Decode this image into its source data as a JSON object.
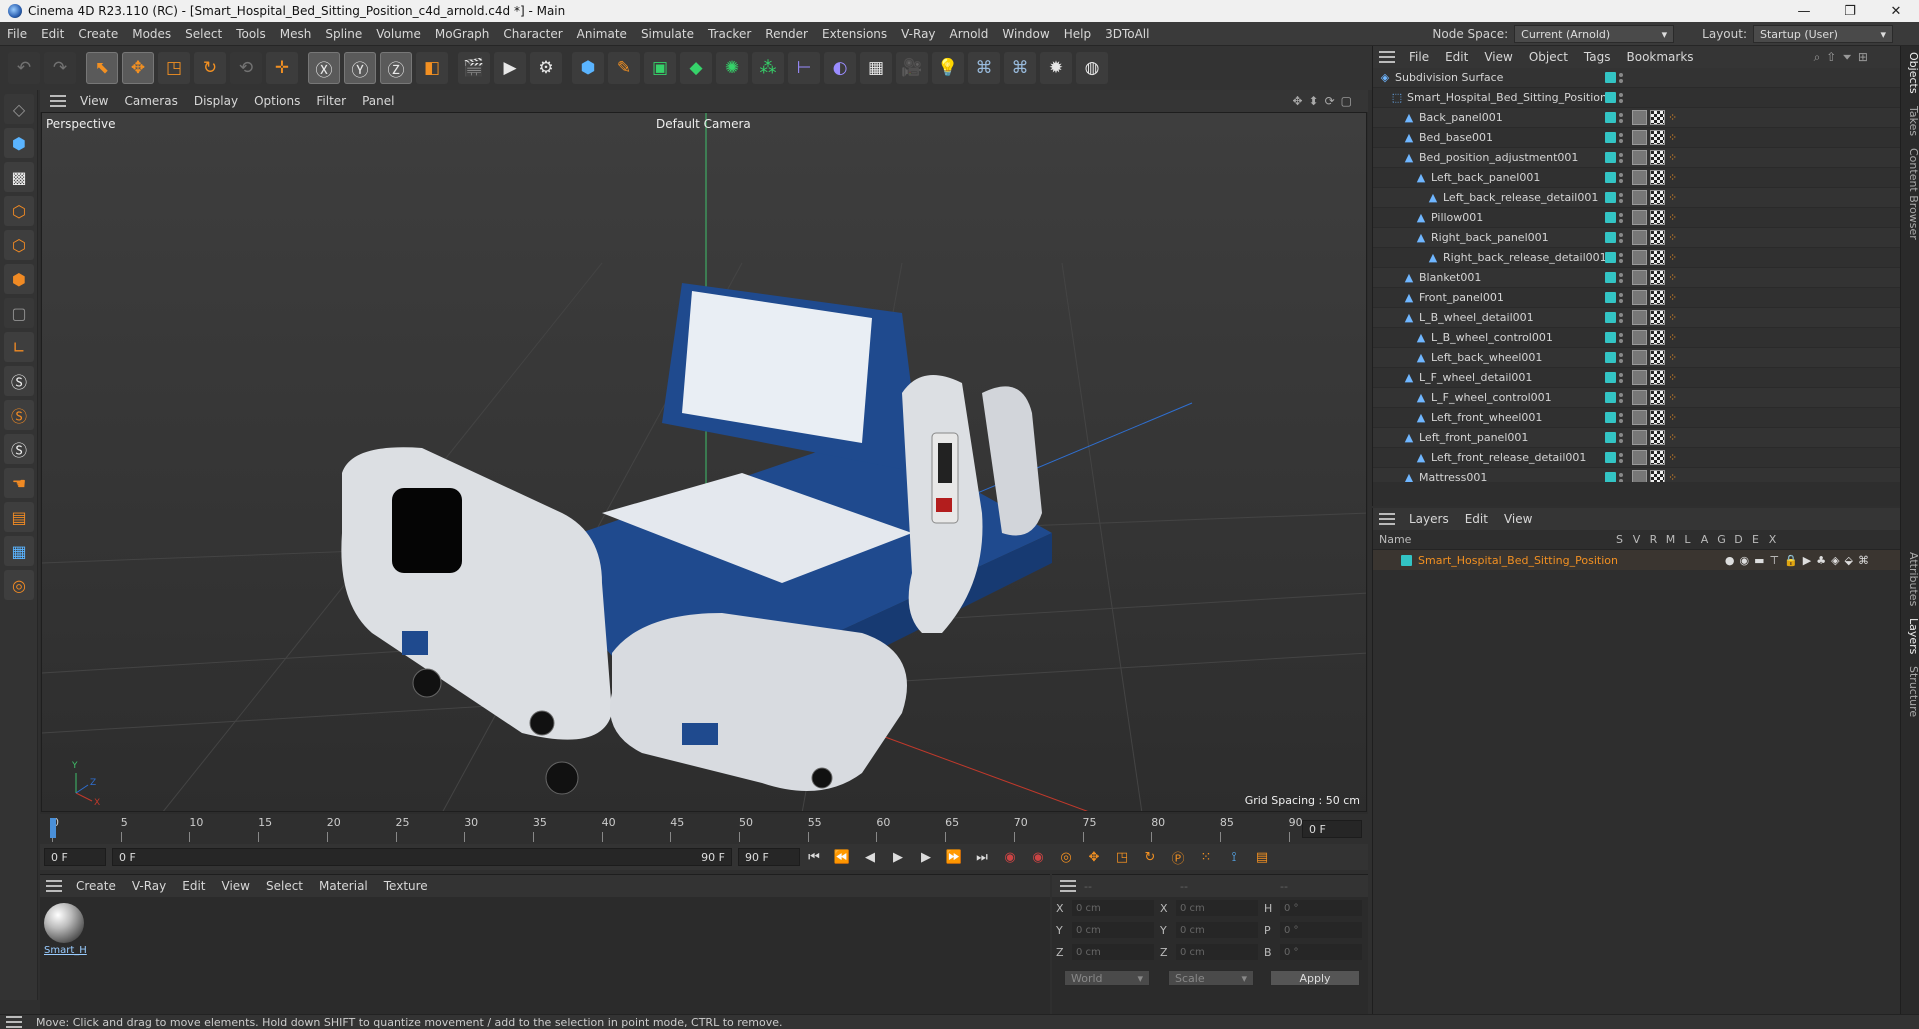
{
  "window": {
    "title": "Cinema 4D R23.110 (RC) - [Smart_Hospital_Bed_Sitting_Position_c4d_arnold.c4d *] - Main",
    "controls": [
      "—",
      "❐",
      "✕"
    ]
  },
  "menubar": {
    "items": [
      "File",
      "Edit",
      "Create",
      "Modes",
      "Select",
      "Tools",
      "Mesh",
      "Spline",
      "Volume",
      "MoGraph",
      "Character",
      "Animate",
      "Simulate",
      "Tracker",
      "Render",
      "Extensions",
      "V-Ray",
      "Arnold",
      "Window",
      "Help",
      "3DToAll"
    ],
    "node_space_label": "Node Space:",
    "node_space_value": "Current (Arnold)",
    "layout_label": "Layout:",
    "layout_value": "Startup (User)"
  },
  "viewport": {
    "menu": [
      "View",
      "Cameras",
      "Display",
      "Options",
      "Filter",
      "Panel"
    ],
    "view_name": "Perspective",
    "camera": "Default Camera",
    "grid_spacing": "Grid Spacing : 50 cm"
  },
  "timeline": {
    "ticks": [
      "0",
      "5",
      "10",
      "15",
      "20",
      "25",
      "30",
      "35",
      "40",
      "45",
      "50",
      "55",
      "60",
      "65",
      "70",
      "75",
      "80",
      "85",
      "90"
    ],
    "current_frame_right": "0 F",
    "start_field": "0 F",
    "range_start": "0 F",
    "range_end": "90 F",
    "end_field": "90 F"
  },
  "material_panel": {
    "menu": [
      "Create",
      "V-Ray",
      "Edit",
      "View",
      "Select",
      "Material",
      "Texture"
    ],
    "material_name": "Smart_H"
  },
  "coords": {
    "headers": [
      "--",
      "--",
      "--"
    ],
    "rows": [
      {
        "a": "X",
        "av": "0 cm",
        "b": "X",
        "bv": "0 cm",
        "c": "H",
        "cv": "0 °"
      },
      {
        "a": "Y",
        "av": "0 cm",
        "b": "Y",
        "bv": "0 cm",
        "c": "P",
        "cv": "0 °"
      },
      {
        "a": "Z",
        "av": "0 cm",
        "b": "Z",
        "bv": "0 cm",
        "c": "B",
        "cv": "0 °"
      }
    ],
    "world": "World",
    "scale": "Scale",
    "apply": "Apply"
  },
  "status": "Move: Click and drag to move elements. Hold down SHIFT to quantize movement / add to the selection in point mode, CTRL to remove.",
  "objects": {
    "menu": [
      "File",
      "Edit",
      "View",
      "Object",
      "Tags",
      "Bookmarks"
    ],
    "items": [
      {
        "name": "Subdivision Surface",
        "indent": 0,
        "tags": false
      },
      {
        "name": "Smart_Hospital_Bed_Sitting_Position",
        "indent": 1,
        "tags": false
      },
      {
        "name": "Back_panel001",
        "indent": 2,
        "tags": true
      },
      {
        "name": "Bed_base001",
        "indent": 2,
        "tags": true
      },
      {
        "name": "Bed_position_adjustment001",
        "indent": 2,
        "tags": true
      },
      {
        "name": "Left_back_panel001",
        "indent": 3,
        "tags": true
      },
      {
        "name": "Left_back_release_detail001",
        "indent": 4,
        "tags": true
      },
      {
        "name": "Pillow001",
        "indent": 3,
        "tags": true
      },
      {
        "name": "Right_back_panel001",
        "indent": 3,
        "tags": true
      },
      {
        "name": "Right_back_release_detail001",
        "indent": 4,
        "tags": true
      },
      {
        "name": "Blanket001",
        "indent": 2,
        "tags": true
      },
      {
        "name": "Front_panel001",
        "indent": 2,
        "tags": true
      },
      {
        "name": "L_B_wheel_detail001",
        "indent": 2,
        "tags": true
      },
      {
        "name": "L_B_wheel_control001",
        "indent": 3,
        "tags": true
      },
      {
        "name": "Left_back_wheel001",
        "indent": 3,
        "tags": true
      },
      {
        "name": "L_F_wheel_detail001",
        "indent": 2,
        "tags": true
      },
      {
        "name": "L_F_wheel_control001",
        "indent": 3,
        "tags": true
      },
      {
        "name": "Left_front_wheel001",
        "indent": 3,
        "tags": true
      },
      {
        "name": "Left_front_panel001",
        "indent": 2,
        "tags": true
      },
      {
        "name": "Left_front_release_detail001",
        "indent": 3,
        "tags": true
      },
      {
        "name": "Mattress001",
        "indent": 2,
        "tags": true
      }
    ]
  },
  "layers": {
    "menu": [
      "Layers",
      "Edit",
      "View"
    ],
    "columns": [
      "Name",
      "S",
      "V",
      "R",
      "M",
      "L",
      "A",
      "G",
      "D",
      "E",
      "X"
    ],
    "layer_name": "Smart_Hospital_Bed_Sitting_Position"
  },
  "side_tabs": [
    "Objects",
    "Takes",
    "Content Browser",
    "Attributes",
    "Layers",
    "Structure"
  ],
  "colors": {
    "accent": "#f29022",
    "cyan": "#33c4c4",
    "bed_blue": "#1f4a8e"
  }
}
